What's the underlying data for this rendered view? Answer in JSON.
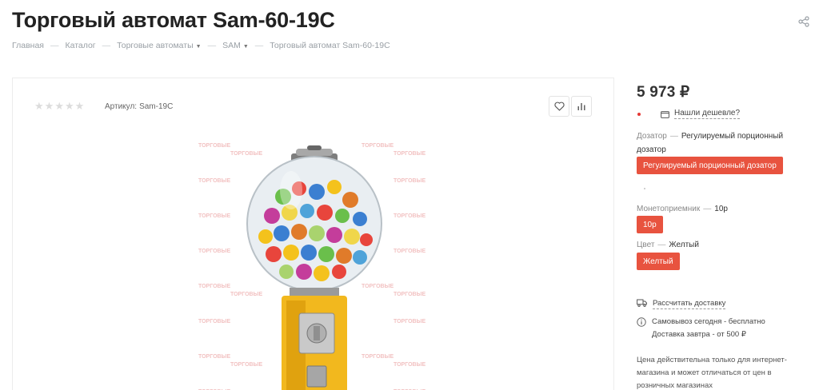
{
  "header": {
    "title": "Торговый автомат Sam-60-19C",
    "share_icon": "share-icon"
  },
  "breadcrumb": [
    {
      "label": "Главная",
      "dropdown": false
    },
    {
      "label": "Каталог",
      "dropdown": false
    },
    {
      "label": "Торговые автоматы",
      "dropdown": true
    },
    {
      "label": "SAM",
      "dropdown": true
    },
    {
      "label": "Торговый автомат Sam-60-19C",
      "dropdown": false
    }
  ],
  "product": {
    "rating_stars": 5,
    "rating_value": 0,
    "article_label": "Артикул:",
    "article_value": "Sam-19C",
    "favorite_icon": "heart-icon",
    "compare_icon": "bar-chart-icon",
    "image_icon": "gumball-machine-image"
  },
  "sidebar": {
    "price": "5 973 ₽",
    "cheaper_link": "Нашли дешевле?",
    "props": {
      "dispenser_label": "Дозатор",
      "dispenser_value": "Регулируемый порционный дозатор",
      "dispenser_chip": "Регулируемый порционный дозатор",
      "coin_label": "Монетоприемник",
      "coin_value": "10р",
      "coin_chip": "10р",
      "color_label": "Цвет",
      "color_value": "Желтый",
      "color_chip": "Желтый"
    },
    "delivery_link": "Рассчитать доставку",
    "pickup_line1": "Самовывоз сегодня - бесплатно",
    "pickup_line2": "Доставка завтра - от 500 ₽",
    "note": "Цена действительна только для интернет-магазина и может отличаться от цен в розничных магазинах"
  },
  "colors": {
    "accent": "#e8533f",
    "status_dot": "#e53935"
  }
}
